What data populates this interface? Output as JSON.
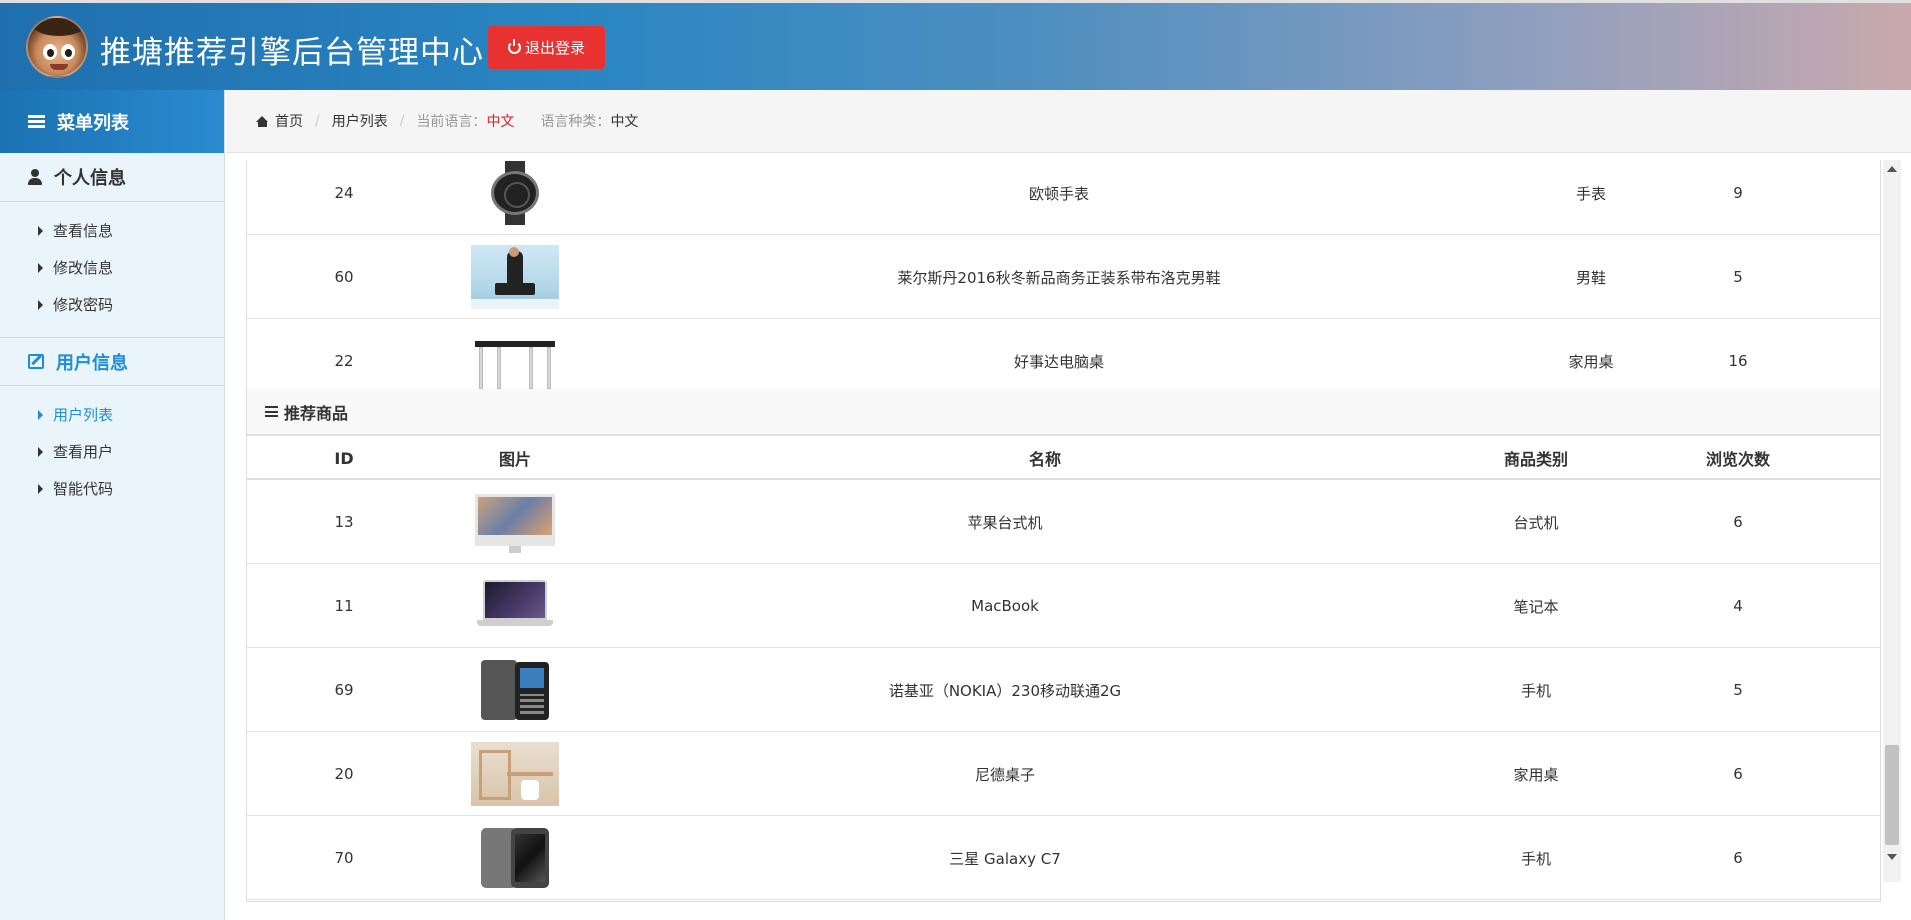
{
  "header": {
    "title": "推塘推荐引擎后台管理中心",
    "logout_label": "退出登录"
  },
  "sidebar": {
    "menu_title": "菜单列表",
    "groups": [
      {
        "title": "个人信息",
        "items": [
          "查看信息",
          "修改信息",
          "修改密码"
        ]
      },
      {
        "title": "用户信息",
        "items": [
          "用户列表",
          "查看用户",
          "智能代码"
        ],
        "active_item": "用户列表"
      }
    ]
  },
  "breadcrumb": {
    "home": "首页",
    "current": "用户列表",
    "current_lang_label": "当前语言：",
    "current_lang_value": "中文",
    "lang_type_label": "语言种类：",
    "lang_type_value": "中文"
  },
  "top_table": {
    "rows": [
      {
        "id": "24",
        "image": "watch-thumbnail",
        "name": "欧顿手表",
        "category": "手表",
        "views": "9"
      },
      {
        "id": "60",
        "image": "man-shoes-thumbnail",
        "name": "莱尔斯丹2016秋冬新品商务正装系带布洛克男鞋",
        "category": "男鞋",
        "views": "5"
      },
      {
        "id": "22",
        "image": "desk-thumbnail",
        "name": "好事达电脑桌",
        "category": "家用桌",
        "views": "16"
      }
    ]
  },
  "recommended": {
    "title": "推荐商品",
    "columns": [
      "ID",
      "图片",
      "名称",
      "商品类别",
      "浏览次数"
    ],
    "rows": [
      {
        "id": "13",
        "image": "imac-thumbnail",
        "name": "苹果台式机",
        "category": "台式机",
        "views": "6"
      },
      {
        "id": "11",
        "image": "macbook-thumbnail",
        "name": "MacBook",
        "category": "笔记本",
        "views": "4"
      },
      {
        "id": "69",
        "image": "nokia-phone-thumbnail",
        "name": "诺基亚（NOKIA）230移动联通2G",
        "category": "手机",
        "views": "5"
      },
      {
        "id": "20",
        "image": "desk-room-thumbnail",
        "name": "尼德桌子",
        "category": "家用桌",
        "views": "6"
      },
      {
        "id": "70",
        "image": "galaxy-phone-thumbnail",
        "name": "三星 Galaxy C7",
        "category": "手机",
        "views": "6"
      }
    ]
  },
  "colors": {
    "accent": "#1f8ed8",
    "logout": "#e83232",
    "lang_highlight": "#e02020"
  }
}
